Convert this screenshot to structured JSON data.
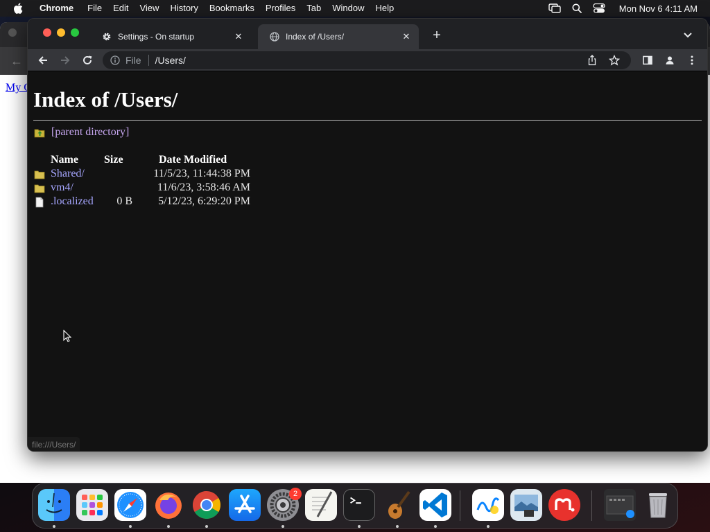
{
  "menubar": {
    "app_name": "Chrome",
    "items": [
      "File",
      "Edit",
      "View",
      "History",
      "Bookmarks",
      "Profiles",
      "Tab",
      "Window",
      "Help"
    ],
    "clock": "Mon Nov 6  4:11 AM"
  },
  "background_window": {
    "link_text": "My Computer"
  },
  "tabs": [
    {
      "title": "Settings - On startup",
      "icon": "gear-icon",
      "active": false
    },
    {
      "title": "Index of /Users/",
      "icon": "globe-icon",
      "active": true
    }
  ],
  "omnibox": {
    "scheme_label": "File",
    "url": "/Users/"
  },
  "page": {
    "heading": "Index of /Users/",
    "parent_link": "[parent directory]",
    "columns": {
      "name": "Name",
      "size": "Size",
      "date": "Date Modified"
    },
    "entries": [
      {
        "name": "Shared/",
        "size": "",
        "date": "11/5/23, 11:44:38 PM",
        "type": "folder"
      },
      {
        "name": "vm4/",
        "size": "",
        "date": "11/6/23, 3:58:46 AM",
        "type": "folder"
      },
      {
        "name": ".localized",
        "size": "0 B",
        "date": "5/12/23, 6:29:20 PM",
        "type": "file"
      }
    ]
  },
  "status_bar": "file:///Users/",
  "dock": {
    "apps": [
      "Finder",
      "Launchpad",
      "Safari",
      "Firefox",
      "Google Chrome",
      "App Store",
      "System Settings",
      "TextEdit",
      "Terminal",
      "GarageBand",
      "Visual Studio Code",
      "Freeform",
      "Preview",
      "Mendeley",
      "Downloads",
      "Trash"
    ],
    "settings_badge": "2"
  },
  "colors": {
    "page_bg": "#121212",
    "link": "#a6a6ff",
    "visited_link": "#c6a6ef",
    "tab_active": "#35363a",
    "tabstrip": "#202124"
  }
}
